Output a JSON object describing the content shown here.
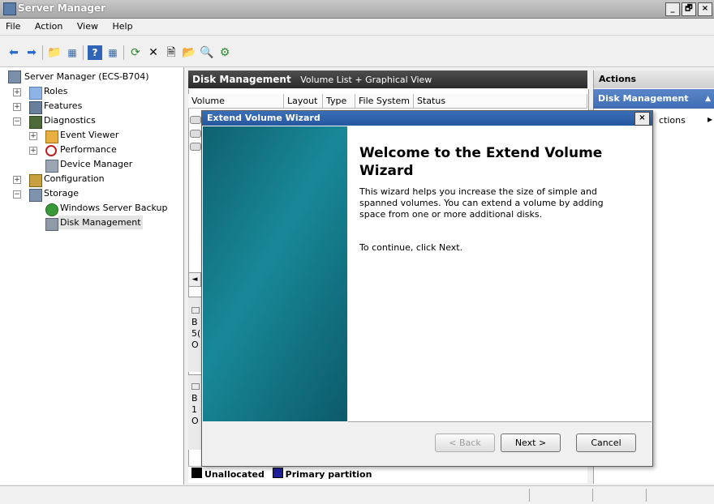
{
  "window": {
    "title": "Server Manager",
    "controls": [
      "_",
      "🗗",
      "×"
    ]
  },
  "menu": [
    "File",
    "Action",
    "View",
    "Help"
  ],
  "tree": {
    "root": "Server Manager (ECS-B704)",
    "roles": "Roles",
    "features": "Features",
    "diagnostics": "Diagnostics",
    "event_viewer": "Event Viewer",
    "performance": "Performance",
    "device_manager": "Device Manager",
    "configuration": "Configuration",
    "storage": "Storage",
    "backup": "Windows Server Backup",
    "disk_mgmt": "Disk Management",
    "expand_plus": "+",
    "expand_minus": "−"
  },
  "middle": {
    "title": "Disk Management",
    "view": "Volume List + Graphical View",
    "columns": [
      "Volume",
      "Layout",
      "Type",
      "File System",
      "Status"
    ],
    "left_partial": [
      "B",
      "5(",
      "O"
    ],
    "left_partial2": [
      "B",
      "1",
      "O"
    ],
    "scroll_left": "◄"
  },
  "actions": {
    "header": "Actions",
    "section": "Disk Management",
    "item": "ctions",
    "item_arrow": "▸",
    "collapse": "▲"
  },
  "dialog": {
    "title": "Extend Volume Wizard",
    "heading": "Welcome to the Extend Volume Wizard",
    "body": "This wizard helps you increase the size of simple and spanned volumes. You can extend a volume  by adding space from one or more additional disks.",
    "instruction": "To continue, click Next.",
    "back": "< Back",
    "next": "Next >",
    "cancel": "Cancel",
    "close": "×"
  },
  "legend": {
    "unallocated": "Unallocated",
    "primary": "Primary partition",
    "unallocated_color": "#000000",
    "primary_color": "#1f1f9c"
  }
}
